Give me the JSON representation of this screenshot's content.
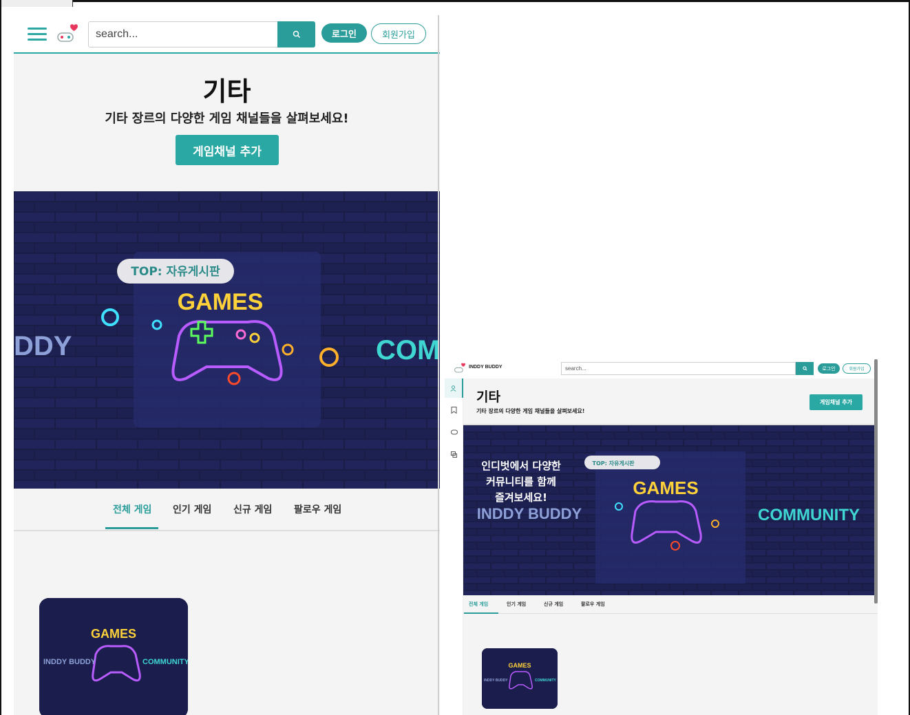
{
  "mobile": {
    "search_placeholder": "search...",
    "login_label": "로그인",
    "join_label": "회원가입",
    "page_title": "기타",
    "page_subtitle": "기타 장르의 다양한 게임 채널들을 살펴보세요!",
    "add_channel_label": "게임채널 추가",
    "banner": {
      "top_badge": "TOP: 자유게시판",
      "games_text": "GAMES",
      "left_text": "DDY",
      "right_text": "COM"
    },
    "tabs": [
      "전체 게임",
      "인기 게임",
      "신규 게임",
      "팔로우 게임"
    ],
    "card": {
      "games_text": "GAMES",
      "left_text": "INDDY BUDDY",
      "right_text": "COMMUNITY"
    }
  },
  "desktop": {
    "brand": "INDDY BUDDY",
    "search_placeholder": "search...",
    "login_label": "로그인",
    "join_label": "회원가입",
    "page_title": "기타",
    "page_subtitle": "기타 장르의 다양한 게임 채널들을 살펴보세요!",
    "add_channel_label": "게임채널 추가",
    "banner": {
      "headline_1": "인디벗에서 다양한",
      "headline_2": "커뮤니티를 함께",
      "headline_3": "즐겨보세요!",
      "top_badge": "TOP: 자유게시판",
      "games_text": "GAMES",
      "left_text": "INDDY BUDDY",
      "right_text": "COMMUNITY"
    },
    "tabs": [
      "전체 게임",
      "인기 게임",
      "신규 게임",
      "팔로우 게임"
    ],
    "card": {
      "games_text": "GAMES",
      "left_text": "INDDY BUDDY",
      "right_text": "COMMUNITY"
    }
  },
  "colors": {
    "accent": "#2a9d9a",
    "banner_bg": "#141633",
    "page_bg": "#f4f4f4"
  },
  "icons": {
    "menu": "hamburger-icon",
    "logo": "heart-gamepad-logo-icon",
    "search": "search-icon",
    "sidebar": [
      "user-icon",
      "bookmark-icon",
      "gamepad-icon",
      "chat-icon"
    ]
  }
}
